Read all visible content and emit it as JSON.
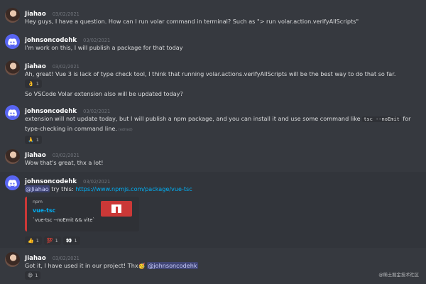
{
  "messages": [
    {
      "user": "Jiahao",
      "avatar": "jiahao-avatar",
      "timestamp": "03/02/2021",
      "lines": [
        "Hey guys, I have a question. How can I run volar command in terminal? Such as \"> run volar.action.verifyAllScripts\""
      ]
    },
    {
      "user": "johnsoncodehk",
      "avatar": "discord-avatar",
      "timestamp": "03/02/2021",
      "lines": [
        "I'm work on this, I will publish a package for that today"
      ]
    },
    {
      "user": "Jiahao",
      "avatar": "jiahao-avatar",
      "timestamp": "03/02/2021",
      "lines": [
        "Ah, great! Vue 3 is lack of type check tool, I think that running volar.actions.verifyAllScripts will be the best way to do that so far."
      ],
      "reactions": [
        {
          "emoji_name": "ok-hand-icon",
          "emoji": "👌",
          "count": "1"
        }
      ],
      "followup": "So VSCode Volar extension also will be updated today?"
    },
    {
      "user": "johnsoncodehk",
      "avatar": "discord-avatar",
      "timestamp": "03/02/2021",
      "text_before": "extension will not update today, but I will publish a npm package, and you can install it and use some command like ",
      "code": "tsc --noEmit",
      "text_after": " for type-checking in command line.",
      "edited": "(edited)",
      "reactions": [
        {
          "emoji_name": "pray-icon",
          "emoji": "🙏",
          "count": "1"
        }
      ]
    },
    {
      "user": "Jiahao",
      "avatar": "jiahao-avatar",
      "timestamp": "03/02/2021",
      "lines": [
        "Wow that's great, thx a lot!"
      ]
    },
    {
      "user": "johnsoncodehk",
      "avatar": "discord-avatar",
      "timestamp": "03/02/2021",
      "mention": "@Jiahao",
      "text_mid": " try this: ",
      "link": "https://www.npmjs.com/package/vue-tsc",
      "embed": {
        "provider": "npm",
        "title": "vue-tsc",
        "description": "`vue-tsc --noEmit && vite`"
      },
      "reactions": [
        {
          "emoji_name": "thumbs-up-icon",
          "emoji": "👍",
          "count": "1"
        },
        {
          "emoji_name": "hundred-icon",
          "emoji": "💯",
          "count": "1"
        },
        {
          "emoji_name": "eyes-icon",
          "emoji": "👀",
          "count": "1"
        }
      ]
    },
    {
      "user": "Jiahao",
      "avatar": "jiahao-avatar",
      "timestamp": "03/02/2021",
      "text_before": "Got it, I have used it in our project! Thx",
      "emoji": "🥳",
      "mention": "@johnsoncodehk",
      "reactions": [
        {
          "emoji_name": "smile-icon",
          "emoji": "😄",
          "count": "1"
        }
      ]
    }
  ],
  "watermark": "@稀土掘金技术社区",
  "colors": {
    "background": "#36393f",
    "accent": "#5865f2",
    "link": "#00aff4",
    "npm": "#cb3837"
  }
}
